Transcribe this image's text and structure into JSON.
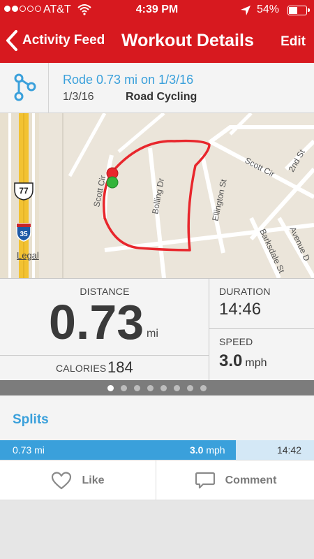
{
  "status_bar": {
    "carrier": "AT&T",
    "time": "4:39 PM",
    "battery": "54%",
    "signal_bars": 2
  },
  "nav": {
    "back_label": "Activity Feed",
    "title": "Workout Details",
    "edit_label": "Edit"
  },
  "activity": {
    "icon": "route-icon",
    "title": "Rode 0.73 mi on 1/3/16",
    "date": "1/3/16",
    "type": "Road Cycling"
  },
  "map": {
    "labels": [
      "Scott Cir",
      "Bolling Dr",
      "Ellington St",
      "Scott Cir",
      "2nd St",
      "Barksdale St",
      "Avenue D"
    ],
    "highway_shields": [
      "77",
      "35"
    ],
    "legal": "Legal"
  },
  "stats": {
    "distance_label": "DISTANCE",
    "distance_value": "0.73",
    "distance_unit": "mi",
    "calories_label": "CALORIES",
    "calories_value": "184",
    "duration_label": "DURATION",
    "duration_value": "14:46",
    "speed_label": "SPEED",
    "speed_value": "3.0",
    "speed_unit": "mph"
  },
  "pager": {
    "count": 8,
    "active_index": 0
  },
  "splits": {
    "title": "Splits",
    "rows": [
      {
        "distance": "0.73 mi",
        "speed": "3.0",
        "speed_unit": "mph",
        "time": "14:42",
        "bar_fraction": 0.75
      }
    ]
  },
  "actions": {
    "like_label": "Like",
    "comment_label": "Comment"
  },
  "colors": {
    "brand_red": "#d7191f",
    "accent_blue": "#3aa0db",
    "route_red": "#e8262c",
    "start_green": "#33b43a"
  }
}
